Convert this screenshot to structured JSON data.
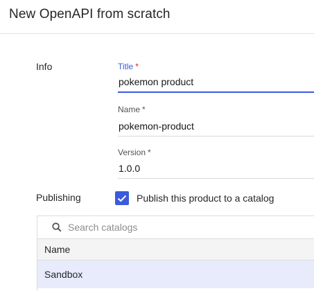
{
  "header": {
    "title": "New OpenAPI from scratch"
  },
  "info": {
    "section_label": "Info",
    "title": {
      "label": "Title",
      "required_mark": "*",
      "value": "pokemon product"
    },
    "name": {
      "label": "Name",
      "required_mark": "*",
      "value": "pokemon-product"
    },
    "version": {
      "label": "Version",
      "required_mark": "*",
      "value": "1.0.0"
    }
  },
  "publishing": {
    "section_label": "Publishing",
    "publish_checkbox": {
      "label": "Publish this product to a catalog",
      "checked": true
    },
    "search": {
      "placeholder": "Search catalogs"
    },
    "table": {
      "columns": [
        "Name"
      ],
      "rows": [
        {
          "name": "Sandbox",
          "selected": true
        }
      ]
    }
  },
  "colors": {
    "accent": "#3b5bdb",
    "required_active": "#da1e28",
    "selected_row": "#e8ebfc"
  }
}
